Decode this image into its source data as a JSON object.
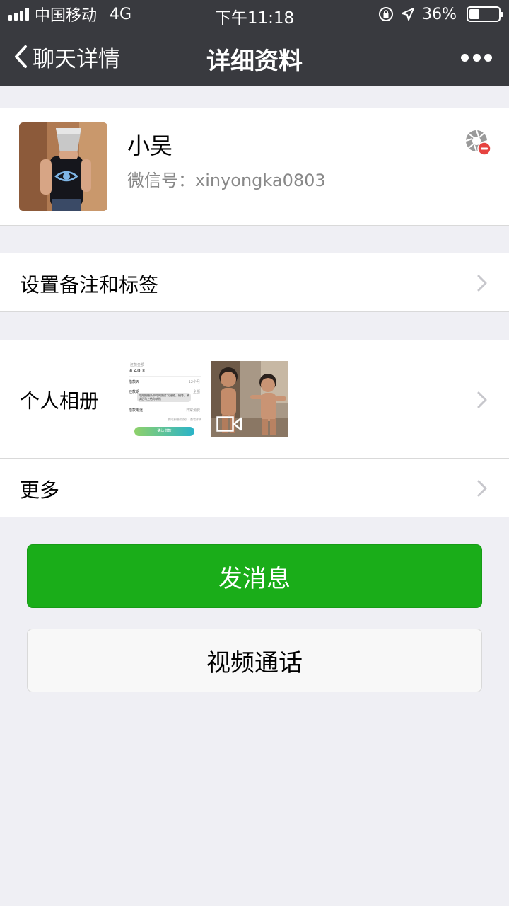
{
  "status_bar": {
    "carrier": "中国移动",
    "network": "4G",
    "time": "下午11:18",
    "battery_percent": "36%",
    "battery_level": 0.36
  },
  "nav": {
    "back_label": "聊天详情",
    "title": "详细资料"
  },
  "profile": {
    "name": "小吴",
    "wechat_id": "微信号：xinyongka0803"
  },
  "rows": {
    "remark_label": "设置备注和标签",
    "album_label": "个人相册",
    "more_label": "更多"
  },
  "album_thumb1": {
    "heading": "还款金额",
    "amount": "¥ 4000",
    "line1_label": "借款天",
    "line1_value": "12个月",
    "line2_label": "还款期",
    "line2_value": "全额",
    "line3_label": "借款用途",
    "line3_value": "日常消费",
    "note": "我同意借款协议 · 查看详情",
    "bubble": "你先把借条中你的照片发给他，稍等，确认后马上给你转账",
    "button": "确认借款"
  },
  "buttons": {
    "send_message": "发消息",
    "video_call": "视频通话"
  },
  "colors": {
    "nav_bg": "#393a3f",
    "page_bg": "#efeff4",
    "primary_green": "#1aad19"
  }
}
